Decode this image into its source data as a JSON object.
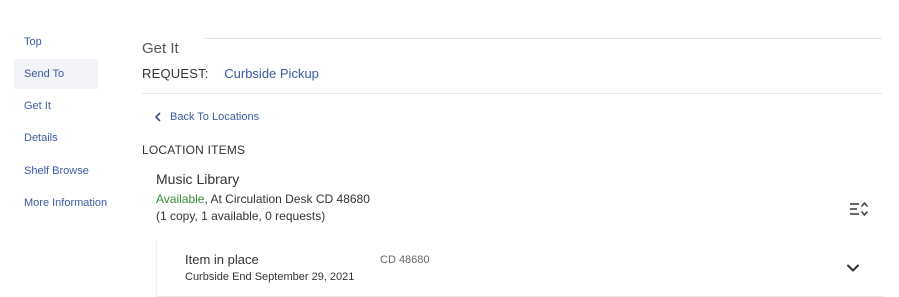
{
  "sidebar": {
    "items": [
      {
        "label": "Top"
      },
      {
        "label": "Send To"
      },
      {
        "label": "Get It"
      },
      {
        "label": "Details"
      },
      {
        "label": "Shelf Browse"
      },
      {
        "label": "More Information"
      }
    ]
  },
  "section": {
    "title": "Get It"
  },
  "request": {
    "label": "REQUEST:",
    "option": "Curbside Pickup"
  },
  "back": {
    "label": "Back To Locations"
  },
  "location_items": {
    "heading": "LOCATION ITEMS"
  },
  "location": {
    "library": "Music Library",
    "status": "Available",
    "location_detail": ", At Circulation Desk CD 48680",
    "counts": "(1 copy, 1 available, 0 requests)"
  },
  "item": {
    "status": "Item in place",
    "call_number": "CD 48680",
    "curbside": "Curbside End September 29, 2021"
  },
  "colors": {
    "link": "#3d5a9e",
    "available": "#3b8c3b"
  }
}
